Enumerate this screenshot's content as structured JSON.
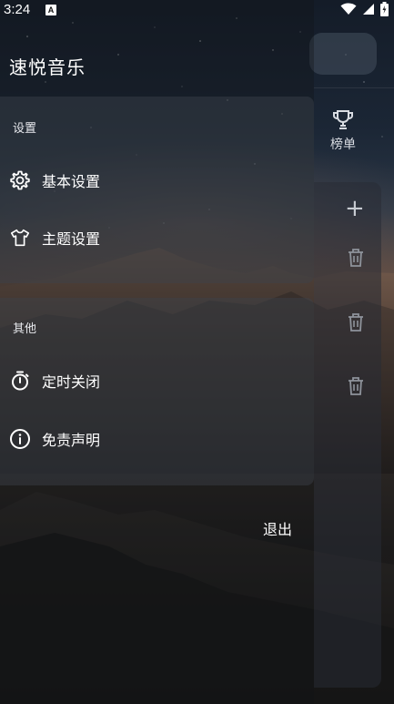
{
  "status_bar": {
    "time": "3:24",
    "notif_icon_letter": "A",
    "icons": [
      "wifi-icon",
      "signal-icon",
      "battery-icon"
    ]
  },
  "drawer": {
    "title": "速悦音乐",
    "groups": [
      {
        "label": "设置",
        "items": [
          {
            "label": "基本设置",
            "icon": "gear-icon"
          },
          {
            "label": "主题设置",
            "icon": "shirt-icon"
          }
        ]
      },
      {
        "label": "其他",
        "items": [
          {
            "label": "定时关闭",
            "icon": "timer-icon"
          },
          {
            "label": "免责声明",
            "icon": "info-icon"
          }
        ]
      }
    ],
    "exit_label": "退出"
  },
  "main": {
    "tab_charts_label": "榜单",
    "icons": [
      "trophy-icon",
      "plus-icon",
      "trash-icon"
    ]
  },
  "colors": {
    "text": "#ffffff",
    "panel": "#3c424c",
    "icon_muted": "#c8ccd2"
  }
}
